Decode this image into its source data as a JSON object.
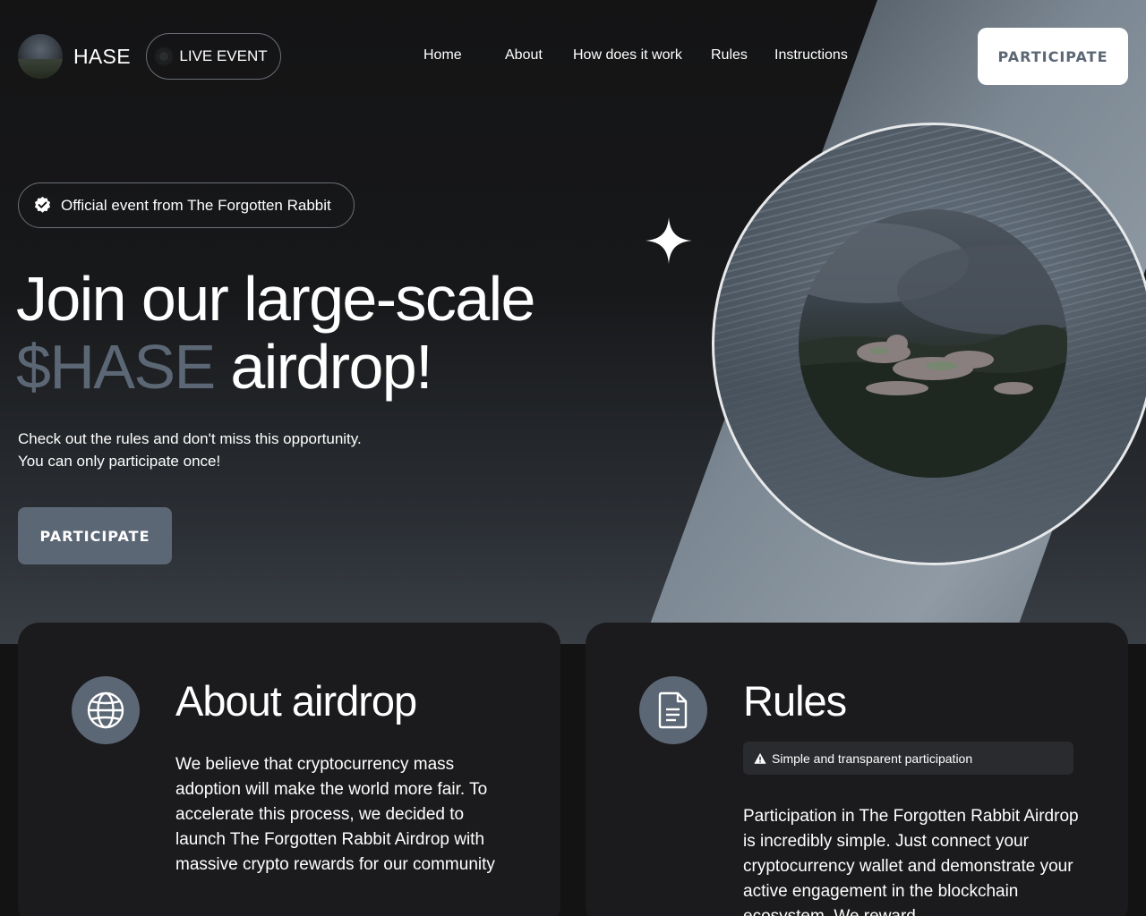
{
  "header": {
    "brand": "HASE",
    "live_label": "LIVE EVENT",
    "nav": [
      {
        "label": "Home"
      },
      {
        "label": "About"
      },
      {
        "label": "How does it work"
      },
      {
        "label": "Rules"
      },
      {
        "label": "Instructions"
      }
    ],
    "cta_label": "PARTICIPATE"
  },
  "hero": {
    "badge": "Official event from The Forgotten Rabbit",
    "headline_line1": "Join our large-scale",
    "headline_accent": "$HASE",
    "headline_rest": "airdrop!",
    "sub_line1": "Check out the rules and don't miss this opportunity.",
    "sub_line2": "You can only participate once!",
    "cta_label": "PARTICIPATE"
  },
  "about": {
    "title": "About airdrop",
    "icon": "globe-icon",
    "body": "We believe that cryptocurrency mass adoption will make the world more fair. To accelerate this process, we decided to launch The Forgotten Rabbit Airdrop with massive crypto rewards for our community"
  },
  "rules": {
    "title": "Rules",
    "icon": "document-icon",
    "note": "Simple and transparent participation",
    "body": "Participation in The Forgotten Rabbit Airdrop is incredibly simple. Just connect your cryptocurrency wallet and demonstrate your active engagement in the blockchain ecosystem. We reward"
  },
  "colors": {
    "accent": "#5c6775",
    "background": "#131314",
    "card": "#1b1b1d"
  }
}
